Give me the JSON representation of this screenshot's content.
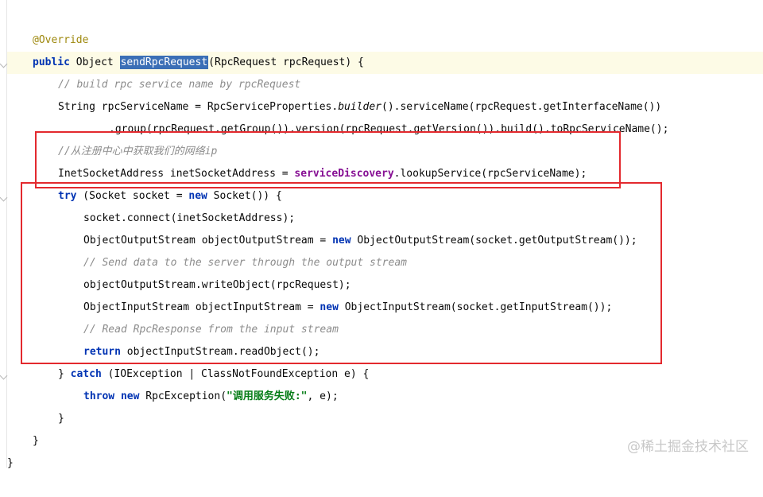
{
  "editor": {
    "highlight_method": "sendRpcRequest",
    "lines": [
      {
        "indent": 0,
        "text_a": "@Override"
      },
      {
        "indent": 0,
        "kw_a": "public",
        "text_a": " Object ",
        "text_b": "(RpcRequest rpcRequest) {"
      },
      {
        "indent": 1,
        "comment": "// build rpc service name by rpcRequest"
      },
      {
        "indent": 1,
        "text_a": "String rpcServiceName = RpcServiceProperties.",
        "italic": "builder",
        "text_b": "().serviceName(rpcRequest.getInterfaceName())"
      },
      {
        "indent": 3,
        "text_a": ".group(rpcRequest.getGroup()).version(rpcRequest.getVersion()).build().toRpcServiceName();"
      },
      {
        "indent": 1,
        "comment": "//从注册中心中获取我们的网络ip"
      },
      {
        "indent": 1,
        "text_a": "InetSocketAddress inetSocketAddress = ",
        "field": "serviceDiscovery",
        "text_b": ".lookupService(rpcServiceName);"
      },
      {
        "indent": 1,
        "kw_a": "try",
        "text_a": " (Socket socket = ",
        "kw_b": "new",
        "text_b": " Socket()) {"
      },
      {
        "indent": 2,
        "text_a": "socket.connect(inetSocketAddress);"
      },
      {
        "indent": 2,
        "text_a": "ObjectOutputStream objectOutputStream = ",
        "kw_b": "new",
        "text_b": " ObjectOutputStream(socket.getOutputStream());"
      },
      {
        "indent": 2,
        "comment": "// Send data to the server through the output stream"
      },
      {
        "indent": 2,
        "text_a": "objectOutputStream.writeObject(rpcRequest);"
      },
      {
        "indent": 2,
        "text_a": "ObjectInputStream objectInputStream = ",
        "kw_b": "new",
        "text_b": " ObjectInputStream(socket.getInputStream());"
      },
      {
        "indent": 2,
        "comment": "// Read RpcResponse from the input stream"
      },
      {
        "indent": 2,
        "kw_a": "return",
        "text_a": " objectInputStream.readObject();"
      },
      {
        "indent": 1,
        "text_a": "} ",
        "kw_b": "catch",
        "text_b": " (IOException | ClassNotFoundException e) {"
      },
      {
        "indent": 2,
        "kw_a": "throw",
        "text_a": " ",
        "kw_b": "new",
        "text_b": " RpcException(",
        "string": "\"调用服务失败:\"",
        "text_c": ", e);"
      },
      {
        "indent": 1,
        "text_a": "}"
      },
      {
        "indent": 0,
        "text_a": "}"
      },
      {
        "indent": -1,
        "text_a": "}"
      }
    ]
  },
  "watermark": "@稀土掘金技术社区",
  "annotation_colors": {
    "red_box": "#e3292e",
    "keyword": "#0033b3",
    "field": "#871094",
    "string": "#067d17"
  }
}
